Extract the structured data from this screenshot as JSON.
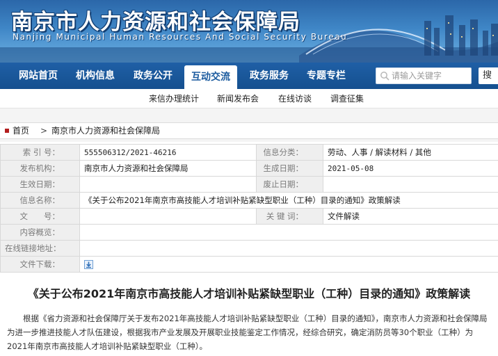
{
  "banner": {
    "title": "南京市人力资源和社会保障局",
    "subtitle": "Nanjing Municipal Human Resources And Social Security Bureau"
  },
  "nav": {
    "items": [
      "网站首页",
      "机构信息",
      "政务公开",
      "互动交流",
      "政务服务",
      "专题专栏"
    ],
    "active": "互动交流",
    "search_placeholder": "请输入关键字",
    "search_button": "搜"
  },
  "subnav": {
    "items": [
      "来信办理统计",
      "新闻发布会",
      "在线访谈",
      "调查征集"
    ]
  },
  "breadcrumb": {
    "home": "首页",
    "separator": ">",
    "current": "南京市人力资源和社会保障局"
  },
  "info": {
    "index_label": "索 引 号：",
    "index_value": "555506312/2021-46216",
    "category_label": "信息分类：",
    "category_value": "劳动、人事 / 解读材料 / 其他",
    "publisher_label": "发布机构：",
    "publisher_value": "南京市人力资源和社会保障局",
    "created_label": "生成日期：",
    "created_value": "2021-05-08",
    "effective_label": "生效日期：",
    "effective_value": "",
    "repeal_label": "废止日期：",
    "repeal_value": "",
    "name_label": "信息名称：",
    "name_value": "《关于公布2021年南京市高技能人才培训补贴紧缺型职业（工种）目录的通知》政策解读",
    "doc_no_label": "文　　号：",
    "doc_no_value": "",
    "keywords_label": "关 键 词：",
    "keywords_value": "文件解读",
    "summary_label": "内容概览：",
    "summary_value": "",
    "link_label": "在线链接地址：",
    "link_value": "",
    "download_label": "文件下载："
  },
  "article": {
    "title": "《关于公布2021年南京市高技能人才培训补贴紧缺型职业（工种）目录的通知》政策解读",
    "body": "根据《省力资源和社会保障厅关于发布2021年高技能人才培训补贴紧缺型职业（工种）目录的通知》，南京市人力资源和社会保障局为进一步推进技能人才队伍建设，根据我市产业发展及开展职业技能鉴定工作情况，经综合研究，确定消防员等30个职业（工种）为2021年南京市高技能人才培训补贴紧缺型职业（工种）。"
  },
  "colors": {
    "nav_bg": "#1a5a9e",
    "label_bg": "#efefef",
    "breadcrumb_dot": "#b31e1e"
  }
}
